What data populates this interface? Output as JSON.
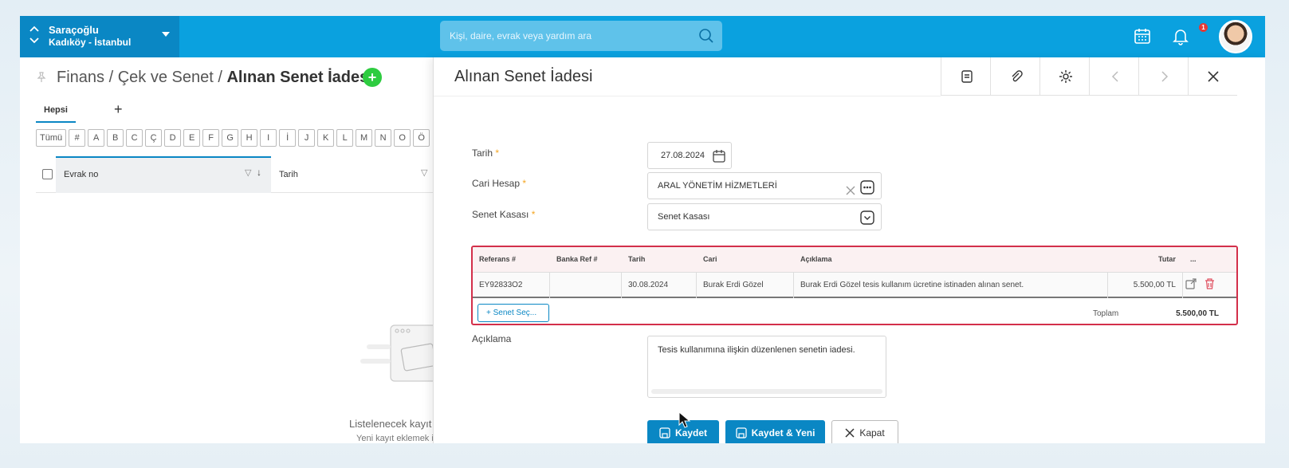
{
  "topbar": {
    "org_name": "Saraçoğlu",
    "org_location": "Kadıköy - İstanbul",
    "search_placeholder": "Kişi, daire, evrak veya yardım ara",
    "notification_count": "1",
    "icons": [
      "chevron-up-icon",
      "chevron-down-icon",
      "caret-down-icon",
      "search-icon",
      "calendar-icon",
      "bell-icon",
      "avatar"
    ]
  },
  "list": {
    "breadcrumb_prefix": "Finans / Çek ve Senet / ",
    "breadcrumb_current": "Alınan Senet İadesi",
    "tab_all": "Hepsi",
    "tab_add": "+",
    "alpha_filters": [
      "Tümü",
      "#",
      "A",
      "B",
      "C",
      "Ç",
      "D",
      "E",
      "F",
      "G",
      "H",
      "I",
      "İ",
      "J",
      "K",
      "L",
      "M",
      "N",
      "O",
      "Ö"
    ],
    "col_evrak": "Evrak no",
    "col_tarih": "Tarih",
    "empty_title": "Listelenecek kayıt",
    "empty_hint": "Yeni kayıt eklemek i"
  },
  "detail": {
    "title": "Alınan Senet İadesi",
    "form": {
      "tarih_label": "Tarih",
      "tarih_value": "27.08.2024",
      "cari_label": "Cari Hesap",
      "cari_value": "ARAL YÖNETİM HİZMETLERİ",
      "kasa_label": "Senet Kasası",
      "kasa_value": "Senet Kasası",
      "aciklama_label": "Açıklama",
      "aciklama_value": "Tesis kullanımına ilişkin düzenlenen senetin iadesi.",
      "required_mark": "*"
    },
    "grid": {
      "headers": [
        "Referans #",
        "Banka Ref #",
        "Tarih",
        "Cari",
        "Açıklama",
        "Tutar",
        "..."
      ],
      "rows": [
        {
          "referans": "EY92833O2",
          "banka_ref": "",
          "tarih": "30.08.2024",
          "cari": "Burak Erdi Gözel",
          "aciklama": "Burak Erdi Gözel tesis kullanım ücretine istinaden alınan senet.",
          "tutar": "5.500,00 TL"
        }
      ],
      "select_button": "Senet Seç...",
      "total_label": "Toplam",
      "total_value": "5.500,00 TL"
    },
    "buttons": {
      "save": "Kaydet",
      "save_new": "Kaydet & Yeni",
      "close": "Kapat"
    },
    "colors": {
      "primary": "#0a87c4",
      "topbar": "#0aa1df",
      "error": "#d32f4a",
      "add": "#2ecc40"
    }
  }
}
